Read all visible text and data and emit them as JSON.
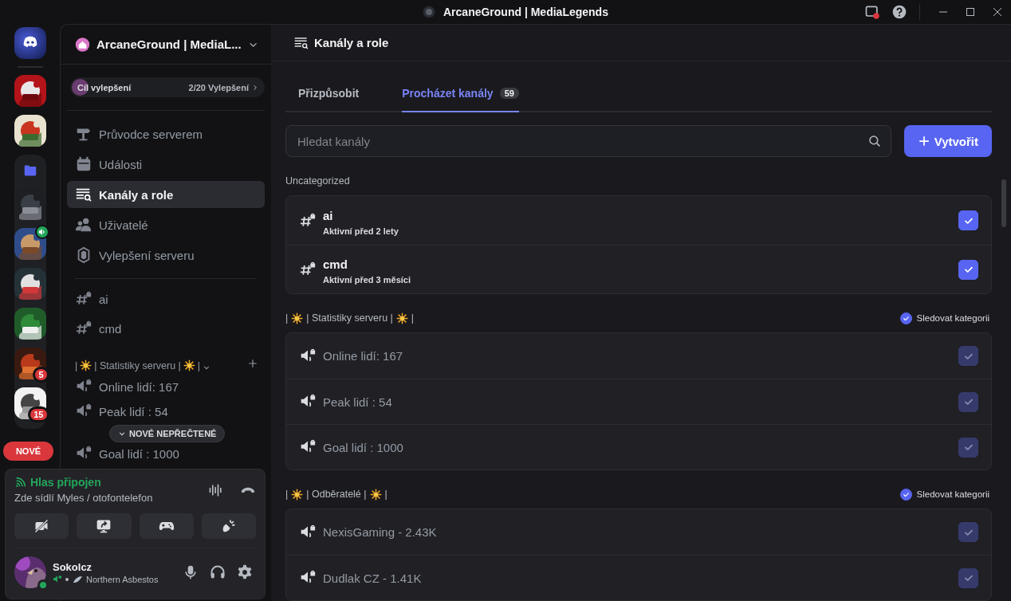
{
  "window": {
    "title": "ArcaneGround | MediaLegends"
  },
  "server_rail": {
    "servers": [
      {
        "folder": false,
        "speaking": false
      },
      {
        "folder": false,
        "speaking": false
      },
      {
        "folder": true,
        "speaking": false
      },
      {
        "folder": true,
        "speaking": true
      },
      {
        "folder": true,
        "speaking": false
      },
      {
        "folder": true,
        "speaking": false
      },
      {
        "folder": true,
        "speaking": false,
        "badge": "5"
      },
      {
        "folder": true,
        "speaking": false,
        "badge": "15"
      }
    ],
    "new_pill": "NOVÉ"
  },
  "sidebar": {
    "server_name": "ArcaneGround | MediaL...",
    "boost": {
      "label": "Cíl vylepšení",
      "progress": "2/20 Vylepšení"
    },
    "nav": [
      {
        "kind": "guide",
        "label": "Průvodce serverem",
        "selected": false
      },
      {
        "kind": "events",
        "label": "Události",
        "selected": false
      },
      {
        "kind": "browse",
        "label": "Kanály a role",
        "selected": true
      },
      {
        "kind": "members",
        "label": "Uživatelé",
        "selected": false
      },
      {
        "kind": "boost",
        "label": "Vylepšení serveru",
        "selected": false
      }
    ],
    "channels": [
      {
        "kind": "text",
        "name": "ai"
      },
      {
        "kind": "text",
        "name": "cmd"
      },
      {
        "kind": "category",
        "title_parts": [
          "|",
          "| Statistiky serveru |",
          "|"
        ]
      },
      {
        "kind": "voice",
        "name": "Online lidí: 167"
      },
      {
        "kind": "voice",
        "name": "Peak lidí : 54"
      },
      {
        "kind": "voice",
        "name": "Goal lidí : 1000"
      }
    ],
    "unread_pill": "NOVÉ NEPŘEČTENÉ"
  },
  "voice_panel": {
    "status": "Hlas připojen",
    "channel": "Zde sídlí Myles / otofontelefon"
  },
  "user": {
    "name": "Sokolcz",
    "activity": "Northern Asbestos"
  },
  "main": {
    "title": "Kanály a role",
    "tabs": [
      {
        "label": "Přizpůsobit",
        "selected": false
      },
      {
        "label": "Procházet kanály",
        "selected": true,
        "count": "59"
      }
    ],
    "search": {
      "placeholder": "Hledat kanály"
    },
    "create_button": "Vytvořit",
    "categories": [
      {
        "title_parts": [
          "Uncategorized"
        ],
        "channels": [
          {
            "kind": "text",
            "name": "ai",
            "activity": "Aktivní před 2 lety",
            "checked": true,
            "disabled": false
          },
          {
            "kind": "text",
            "name": "cmd",
            "activity": "Aktivní před 3 měsíci",
            "checked": true,
            "disabled": false
          }
        ]
      },
      {
        "title_parts": [
          "|",
          "| Statistiky serveru |",
          "|"
        ],
        "follow_label": "Sledovat kategorii",
        "follow_checked": true,
        "channels": [
          {
            "kind": "voice",
            "name": "Online lidí: 167",
            "checked": true,
            "disabled": true
          },
          {
            "kind": "voice",
            "name": "Peak lidí : 54",
            "checked": true,
            "disabled": true
          },
          {
            "kind": "voice",
            "name": "Goal lidí : 1000",
            "checked": true,
            "disabled": true
          }
        ]
      },
      {
        "title_parts": [
          "|",
          "| Odběratelé |",
          "|"
        ],
        "follow_label": "Sledovat kategorii",
        "follow_checked": true,
        "channels": [
          {
            "kind": "voice",
            "name": "NexisGaming - 2.43K",
            "checked": true,
            "disabled": true
          },
          {
            "kind": "voice",
            "name": "Dudlak CZ - 1.41K",
            "checked": true,
            "disabled": true
          }
        ]
      }
    ]
  }
}
